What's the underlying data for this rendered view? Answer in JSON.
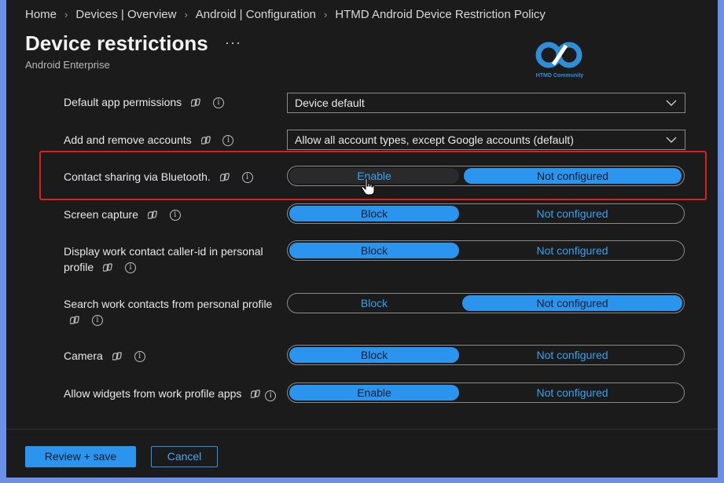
{
  "breadcrumb": [
    "Home",
    "Devices | Overview",
    "Android | Configuration",
    "HTMD Android Device Restriction Policy"
  ],
  "header": {
    "title": "Device restrictions",
    "more": "···",
    "subtitle": "Android Enterprise"
  },
  "logo": {
    "text": "HTMD Community",
    "color": "#2f8fd6"
  },
  "settings": [
    {
      "label": "Default app permissions",
      "type": "select",
      "value": "Device default"
    },
    {
      "label": "Add and remove accounts",
      "type": "select",
      "value": "Allow all account types, except Google accounts (default)"
    },
    {
      "label": "Contact sharing via Bluetooth.",
      "type": "toggle",
      "left": "Enable",
      "right": "Not configured",
      "selected": "right",
      "highlighted": true
    },
    {
      "label": "Screen capture",
      "type": "toggle",
      "left": "Block",
      "right": "Not configured",
      "selected": "left"
    },
    {
      "label": "Display work contact caller-id in personal profile",
      "type": "toggle",
      "left": "Block",
      "right": "Not configured",
      "selected": "left"
    },
    {
      "label": "Search work contacts from personal profile",
      "type": "toggle",
      "left": "Block",
      "right": "Not configured",
      "selected": "right"
    },
    {
      "label": "Camera",
      "type": "toggle",
      "left": "Block",
      "right": "Not configured",
      "selected": "left"
    },
    {
      "label": "Allow widgets from work profile apps",
      "type": "toggle",
      "left": "Enable",
      "right": "Not configured",
      "selected": "left"
    }
  ],
  "footer": {
    "primary": "Review + save",
    "secondary": "Cancel"
  },
  "colors": {
    "accent": "#2b95ee",
    "highlight": "#e01e1e",
    "background": "#1b1b1b"
  }
}
